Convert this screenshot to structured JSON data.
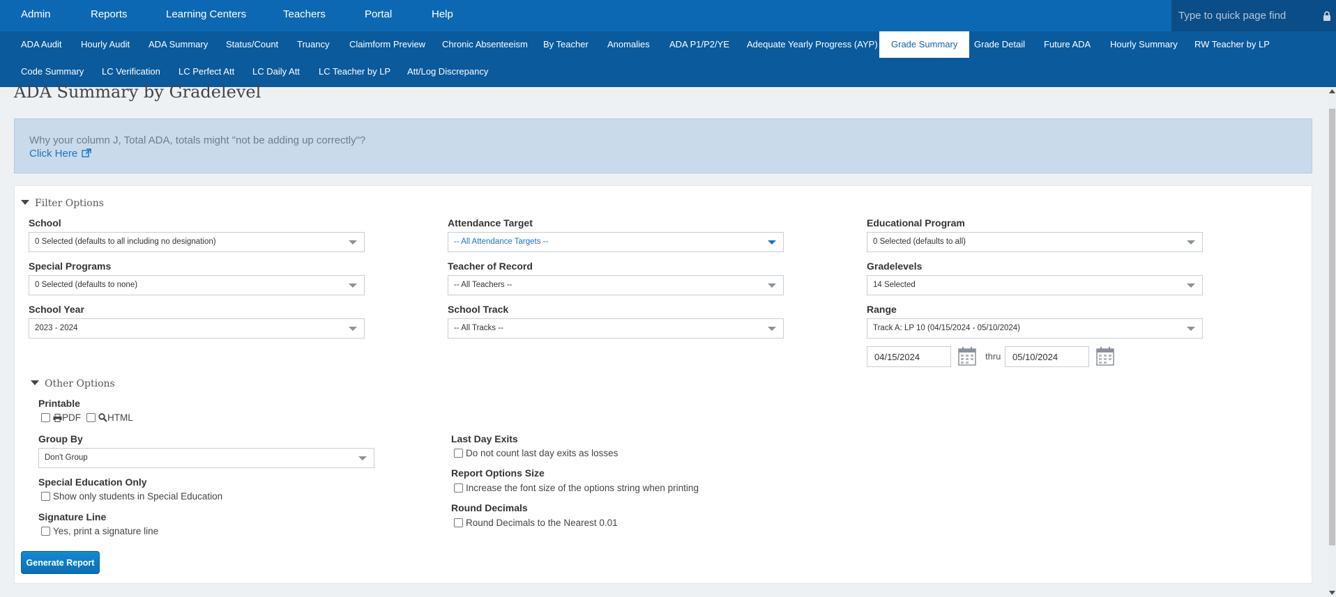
{
  "topnav": {
    "items": [
      "Admin",
      "Reports",
      "Learning Centers",
      "Teachers",
      "Portal",
      "Help"
    ],
    "quickfind_placeholder": "Type to quick page find"
  },
  "subnav": {
    "tabs": [
      "ADA Audit",
      "Hourly Audit",
      "ADA Summary",
      "Status/Count",
      "Truancy",
      "Claimform Preview",
      "Chronic Absenteeism",
      "By Teacher",
      "Anomalies",
      "ADA P1/P2/YE",
      "Adequate Yearly Progress (AYP)",
      "Grade Summary",
      "Grade Detail",
      "Future ADA",
      "Hourly Summary",
      "RW Teacher by LP",
      "Code Summary",
      "LC Verification",
      "LC Perfect Att",
      "LC Daily Att",
      "LC Teacher by LP",
      "Att/Log Discrepancy"
    ],
    "active": "Grade Summary"
  },
  "page": {
    "title": "ADA Summary by Gradelevel",
    "info_text": "Why your column J, Total ADA, totals might \"not be adding up correctly\"?",
    "info_link": "Click Here"
  },
  "filter": {
    "heading": "Filter Options",
    "school": {
      "label": "School",
      "value": "0 Selected (defaults to all including no designation)"
    },
    "attendance_target": {
      "label": "Attendance Target",
      "value": "-- All Attendance Targets --"
    },
    "educational_program": {
      "label": "Educational Program",
      "value": "0 Selected (defaults to all)"
    },
    "special_programs": {
      "label": "Special Programs",
      "value": "0 Selected (defaults to none)"
    },
    "teacher_of_record": {
      "label": "Teacher of Record",
      "value": "-- All Teachers --"
    },
    "gradelevels": {
      "label": "Gradelevels",
      "value": "14 Selected"
    },
    "school_year": {
      "label": "School Year",
      "value": "2023 - 2024"
    },
    "school_track": {
      "label": "School Track",
      "value": "-- All Tracks --"
    },
    "range": {
      "label": "Range",
      "value": "Track A: LP 10 (04/15/2024 - 05/10/2024)",
      "start": "04/15/2024",
      "thru": "thru",
      "end": "05/10/2024"
    }
  },
  "other": {
    "heading": "Other Options",
    "printable": {
      "label": "Printable",
      "pdf": "PDF",
      "html": "HTML"
    },
    "group_by": {
      "label": "Group By",
      "value": "Don't Group"
    },
    "special_ed": {
      "label": "Special Education Only",
      "option": "Show only students in Special Education"
    },
    "signature": {
      "label": "Signature Line",
      "option": "Yes, print a signature line"
    },
    "last_day_exits": {
      "label": "Last Day Exits",
      "option": "Do not count last day exits as losses"
    },
    "report_options_size": {
      "label": "Report Options Size",
      "option": "Increase the font size of the options string when printing"
    },
    "round_decimals": {
      "label": "Round Decimals",
      "option": "Round Decimals to the Nearest 0.01"
    }
  },
  "generate_button": "Generate Report"
}
